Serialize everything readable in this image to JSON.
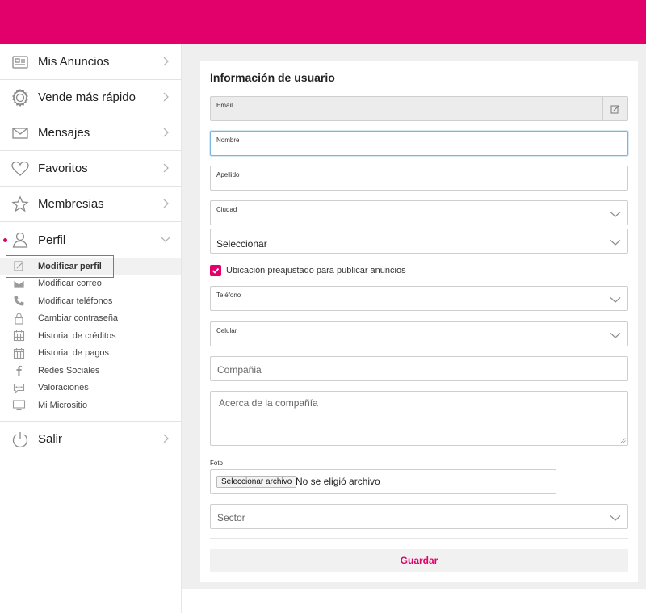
{
  "colors": {
    "brand": "#e2006a",
    "active_frame": "#c24fa6",
    "focus_border": "#7ab6e0"
  },
  "sidebar": {
    "items": [
      {
        "label": "Mis Anuncios",
        "icon": "id-card-icon"
      },
      {
        "label": "Vende más rápido",
        "icon": "badge-icon"
      },
      {
        "label": "Mensajes",
        "icon": "envelope-icon"
      },
      {
        "label": "Favoritos",
        "icon": "heart-icon"
      },
      {
        "label": "Membresias",
        "icon": "star-icon"
      },
      {
        "label": "Perfil",
        "icon": "user-icon",
        "expanded": true
      }
    ],
    "submenu": [
      {
        "label": "Modificar perfil",
        "icon": "edit-icon",
        "active": true
      },
      {
        "label": "Modificar correo",
        "icon": "envelope-icon"
      },
      {
        "label": "Modificar teléfonos",
        "icon": "phone-icon"
      },
      {
        "label": "Cambiar contraseña",
        "icon": "lock-icon"
      },
      {
        "label": "Historial de créditos",
        "icon": "calendar-icon"
      },
      {
        "label": "Historial de pagos",
        "icon": "calendar-icon"
      },
      {
        "label": "Redes Sociales",
        "icon": "facebook-icon"
      },
      {
        "label": "Valoraciones",
        "icon": "chat-icon"
      },
      {
        "label": "Mi Micrositio",
        "icon": "monitor-icon"
      }
    ],
    "logout": {
      "label": "Salir",
      "icon": "power-icon"
    }
  },
  "form": {
    "title": "Información de usuario",
    "email": {
      "label": "Email",
      "value": ""
    },
    "nombre": {
      "label": "Nombre",
      "value": ""
    },
    "apellido": {
      "label": "Apellido",
      "value": ""
    },
    "ciudad": {
      "label": "Ciudad"
    },
    "select_city": {
      "selected": "Seleccionar"
    },
    "preset_location": {
      "label": "Ubicación preajustado para publicar anuncios",
      "checked": true
    },
    "telefono": {
      "label": "Teléfono"
    },
    "celular": {
      "label": "Celular"
    },
    "compania": {
      "placeholder": "Compañia"
    },
    "acerca": {
      "placeholder": "Acerca de la compañía"
    },
    "foto": {
      "label": "Foto",
      "button": "Seleccionar archivo",
      "status": "No se eligió archivo"
    },
    "sector": {
      "placeholder": "Sector"
    },
    "save_label": "Guardar"
  }
}
